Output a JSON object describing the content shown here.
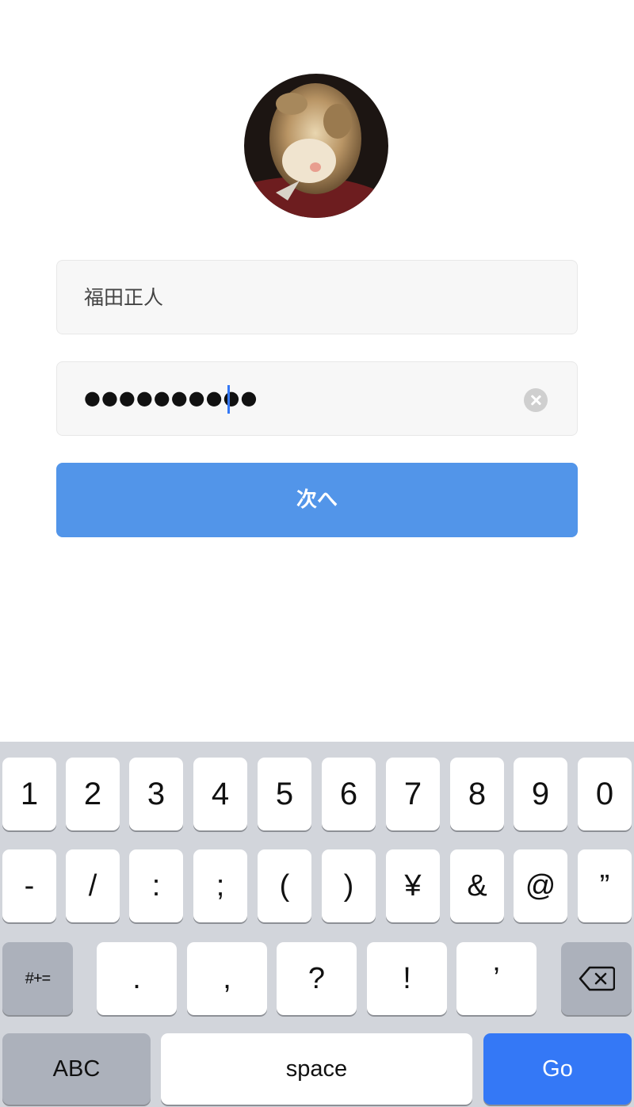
{
  "login": {
    "username": "福田正人",
    "password_masked": "●●●●●●●●●●",
    "next_label": "次へ"
  },
  "keyboard": {
    "row1": [
      "1",
      "2",
      "3",
      "4",
      "5",
      "6",
      "7",
      "8",
      "9",
      "0"
    ],
    "row2": [
      "-",
      "/",
      ":",
      ";",
      "(",
      ")",
      "¥",
      "&",
      "@",
      "”"
    ],
    "row3": {
      "symbols": "#+=",
      "keys": [
        ".",
        ",",
        "?",
        "!",
        "’"
      ]
    },
    "row4": {
      "abc": "ABC",
      "space": "space",
      "go": "Go"
    }
  },
  "colors": {
    "accent": "#5295e9",
    "go_key": "#3478f6",
    "keyboard_bg": "#d2d5db"
  },
  "icons": {
    "clear": "clear-circle-icon",
    "backspace": "backspace-icon"
  }
}
